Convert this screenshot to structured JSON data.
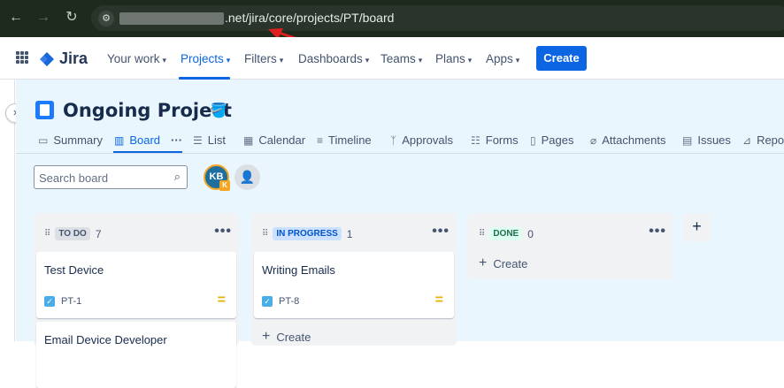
{
  "browser": {
    "url_visible": ".net/jira/core/projects/PT/board"
  },
  "topnav": {
    "logo_text": "Jira",
    "items": [
      {
        "label": "Your work"
      },
      {
        "label": "Projects"
      },
      {
        "label": "Filters"
      },
      {
        "label": "Dashboards"
      },
      {
        "label": "Teams"
      },
      {
        "label": "Plans"
      },
      {
        "label": "Apps"
      }
    ],
    "create_label": "Create"
  },
  "project": {
    "title": "Ongoing Project"
  },
  "tabs": [
    {
      "label": "Summary"
    },
    {
      "label": "Board"
    },
    {
      "label": "List"
    },
    {
      "label": "Calendar"
    },
    {
      "label": "Timeline"
    },
    {
      "label": "Approvals"
    },
    {
      "label": "Forms"
    },
    {
      "label": "Pages"
    },
    {
      "label": "Attachments"
    },
    {
      "label": "Issues"
    },
    {
      "label": "Repo"
    }
  ],
  "toolbar": {
    "search_placeholder": "Search board",
    "avatar_initials": "KB",
    "avatar_badge": "K"
  },
  "columns": [
    {
      "status": "TO DO",
      "count": "7",
      "status_bg": "#dcdfe4",
      "status_fg": "#44546f",
      "cards": [
        {
          "title": "Test Device",
          "key": "PT-1"
        },
        {
          "title": "Email Device Developer",
          "key": ""
        }
      ]
    },
    {
      "status": "IN PROGRESS",
      "count": "1",
      "status_bg": "#cce0ff",
      "status_fg": "#0055cc",
      "cards": [
        {
          "title": "Writing Emails",
          "key": "PT-8"
        }
      ],
      "create_label": "Create"
    },
    {
      "status": "DONE",
      "count": "0",
      "status_bg": "#dcfff1",
      "status_fg": "#216e4e",
      "cards": [],
      "create_label": "Create"
    }
  ],
  "colors": {
    "accent": "#0c66e4",
    "board_bg": "#e9f6fd",
    "annotation_arrow": "#e01e1e"
  }
}
